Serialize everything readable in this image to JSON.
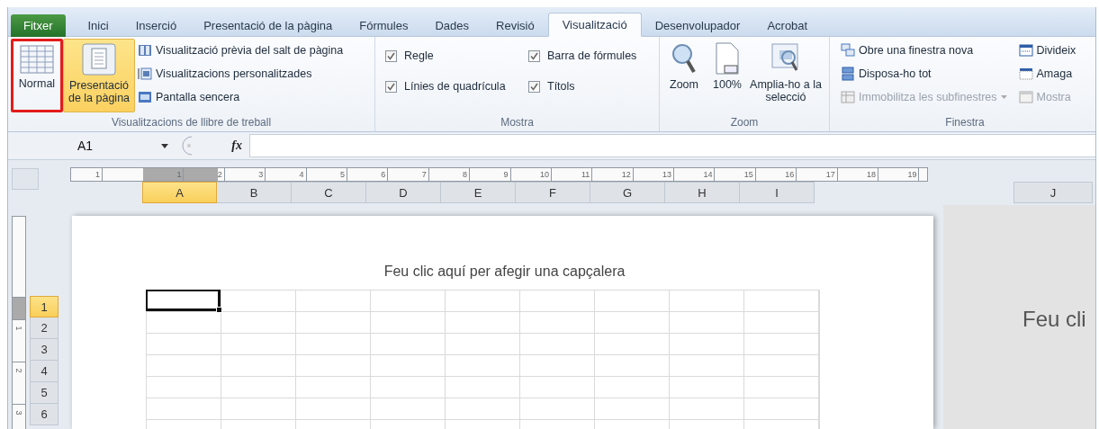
{
  "tabs": [
    {
      "label": "Fitxer",
      "kind": "file",
      "selected": false
    },
    {
      "label": "Inici",
      "kind": "tab",
      "selected": false
    },
    {
      "label": "Inserció",
      "kind": "tab",
      "selected": false
    },
    {
      "label": "Presentació de la pàgina",
      "kind": "tab",
      "selected": false
    },
    {
      "label": "Fórmules",
      "kind": "tab",
      "selected": false
    },
    {
      "label": "Dades",
      "kind": "tab",
      "selected": false
    },
    {
      "label": "Revisió",
      "kind": "tab",
      "selected": false
    },
    {
      "label": "Visualització",
      "kind": "tab",
      "selected": true
    },
    {
      "label": "Desenvolupador",
      "kind": "tab",
      "selected": false
    },
    {
      "label": "Acrobat",
      "kind": "tab",
      "selected": false
    }
  ],
  "ribbon_groups": [
    {
      "kind": "views",
      "label": "Visualitzacions de llibre de treball",
      "large_buttons": [
        {
          "label": "Normal",
          "selected": false,
          "highlighted": true
        },
        {
          "label": "Presentació de la pàgina",
          "selected": true,
          "highlighted": false
        }
      ],
      "items": [
        {
          "label": "Visualització prèvia del salt de pàgina"
        },
        {
          "label": "Visualitzacions personalitzades"
        },
        {
          "label": "Pantalla sencera"
        }
      ]
    },
    {
      "kind": "show",
      "label": "Mostra",
      "checkboxes": [
        {
          "label": "Regle",
          "checked": true
        },
        {
          "label": "Línies de quadrícula",
          "checked": true
        },
        {
          "label": "Barra de fórmules",
          "checked": true
        },
        {
          "label": "Títols",
          "checked": true
        }
      ]
    },
    {
      "kind": "zoom",
      "label": "Zoom",
      "large_buttons": [
        {
          "label": "Zoom"
        },
        {
          "label": "100%"
        },
        {
          "label": "Amplia-ho a la selecció"
        }
      ]
    },
    {
      "kind": "window",
      "label": "Finestra",
      "items": [
        {
          "label": "Obre una finestra nova",
          "disabled": false,
          "dropdown": false
        },
        {
          "label": "Disposa-ho tot",
          "disabled": false,
          "dropdown": false
        },
        {
          "label": "Immobilitza les subfinestres",
          "disabled": true,
          "dropdown": true
        },
        {
          "label": "Divideix",
          "disabled": false,
          "dropdown": false
        },
        {
          "label": "Amaga",
          "disabled": false,
          "dropdown": false
        },
        {
          "label": "Mostra",
          "disabled": true,
          "dropdown": false
        }
      ]
    }
  ],
  "formula_bar": {
    "name_box": "A1",
    "function_label": "fx"
  },
  "sheet": {
    "ruler_numbers": [
      "1",
      "1",
      "2",
      "3",
      "4",
      "5",
      "6",
      "7",
      "8",
      "9",
      "10",
      "11",
      "12",
      "13",
      "14",
      "15",
      "16",
      "17",
      "18",
      "19"
    ],
    "vertical_ruler_numbers": [
      "1",
      "2",
      "3"
    ],
    "columns": [
      {
        "label": "A",
        "selected": true
      },
      {
        "label": "B",
        "selected": false
      },
      {
        "label": "C",
        "selected": false
      },
      {
        "label": "D",
        "selected": false
      },
      {
        "label": "E",
        "selected": false
      },
      {
        "label": "F",
        "selected": false
      },
      {
        "label": "G",
        "selected": false
      },
      {
        "label": "H",
        "selected": false
      },
      {
        "label": "I",
        "selected": false
      }
    ],
    "rows": [
      {
        "label": "1",
        "selected": true
      },
      {
        "label": "2",
        "selected": false
      },
      {
        "label": "3",
        "selected": false
      },
      {
        "label": "4",
        "selected": false
      },
      {
        "label": "5",
        "selected": false
      },
      {
        "label": "6",
        "selected": false
      }
    ],
    "header_placeholder": "Feu clic aquí per afegir una capçalera",
    "next_page": {
      "column": "J",
      "header_text": "Feu cli"
    }
  }
}
